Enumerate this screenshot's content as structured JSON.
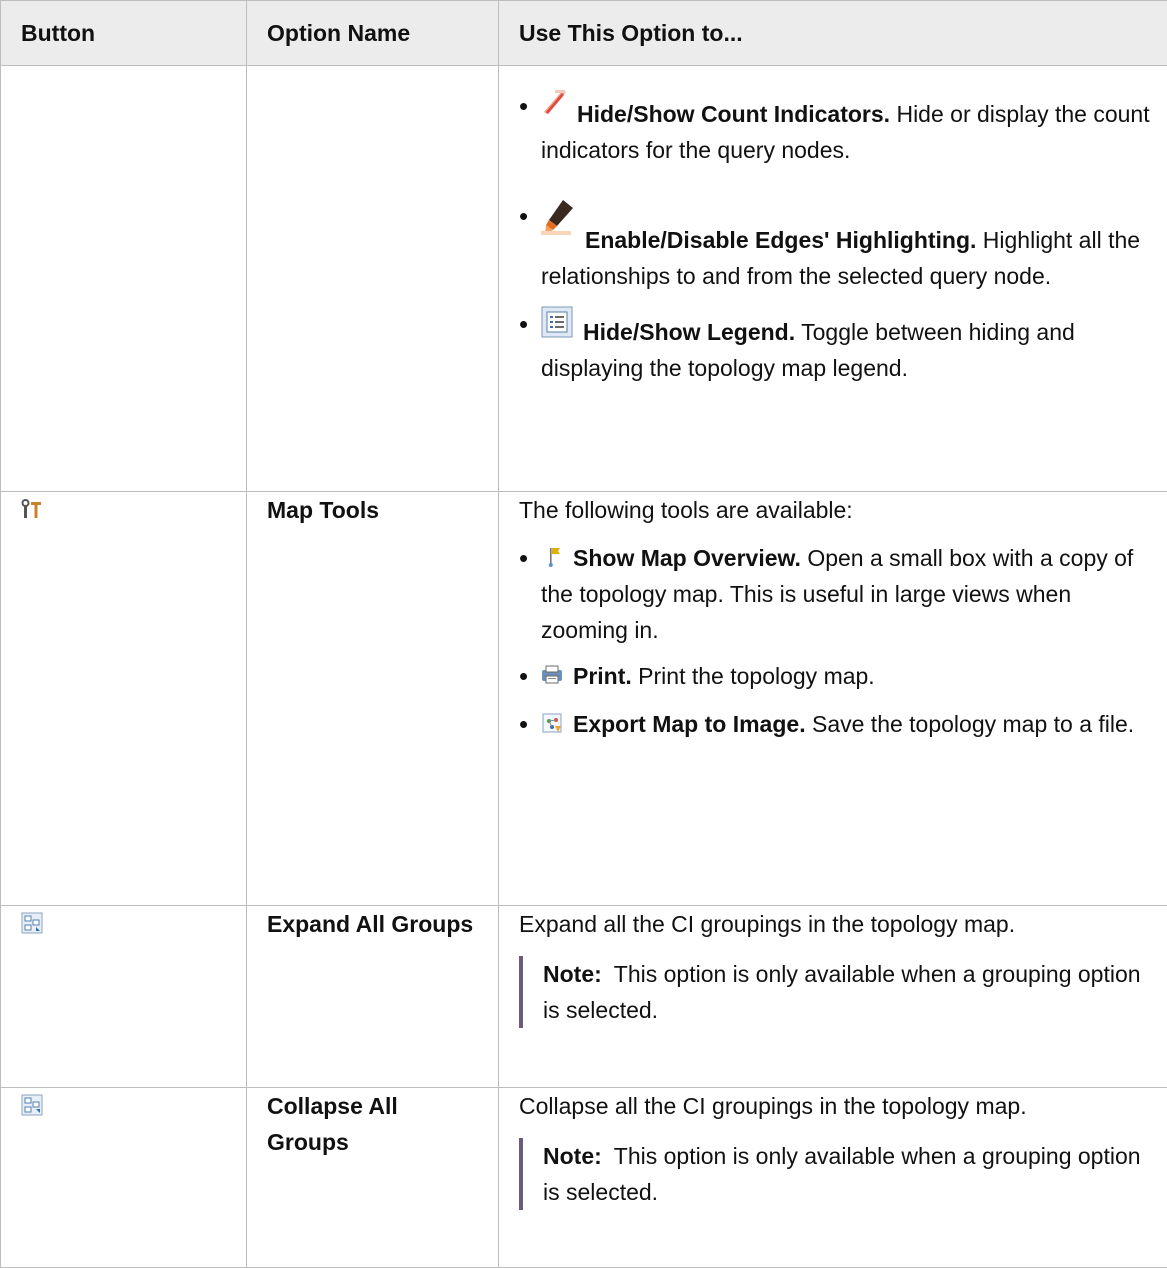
{
  "table": {
    "headers": {
      "button": "Button",
      "option": "Option Name",
      "use": "Use This Option to..."
    }
  },
  "row1": {
    "items": [
      {
        "icon": "count-indicators-icon",
        "title": "Hide/Show Count Indicators.",
        "text": "Hide or display the count indicators for the query nodes."
      },
      {
        "icon": "highlighter-icon",
        "title": "Enable/Disable Edges' Highlighting.",
        "text": "Highlight all the relationships to and from the selected query node."
      },
      {
        "icon": "legend-icon",
        "title": "Hide/Show Legend.",
        "text": "Toggle between hiding and displaying the topology map legend."
      }
    ]
  },
  "row2": {
    "button_icon": "map-tools-icon",
    "name": "Map Tools",
    "intro": "The following tools are available:",
    "items": [
      {
        "icon": "map-overview-icon",
        "title": "Show Map Overview.",
        "text": "Open a small box with a copy of the topology map. This is useful in large views when zooming in."
      },
      {
        "icon": "print-icon",
        "title": "Print.",
        "text": "Print the topology map."
      },
      {
        "icon": "export-image-icon",
        "title": "Export Map to Image.",
        "text": "Save the topology map to a file."
      }
    ]
  },
  "row3": {
    "button_icon": "expand-groups-icon",
    "name": "Expand All Groups",
    "desc": "Expand all the CI groupings in the topology map.",
    "note_label": "Note:",
    "note_text": "This option is only available when a grouping option is selected."
  },
  "row4": {
    "button_icon": "collapse-groups-icon",
    "name": "Collapse All Groups",
    "desc": "Collapse all the CI groupings in the topology map.",
    "note_label": "Note:",
    "note_text": "This option is only available when a grouping option is selected."
  }
}
